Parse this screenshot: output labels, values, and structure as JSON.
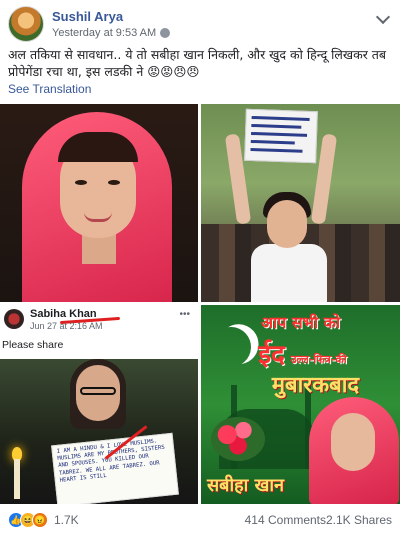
{
  "post": {
    "author": "Sushil Arya",
    "timestamp": "Yesterday at 9:53 AM",
    "text": "अल तकिया से सावधान.. ये तो सबीहा खान निकली, और खुद को हिन्दू लिखकर तब प्रोपेगेंडा रचा था, इस लडकी ने 😡😡😠😠",
    "see_translation": "See Translation"
  },
  "photos": {
    "screenshot": {
      "name": "Sabiha Khan",
      "date": "Jun 27 at 2:16 AM",
      "caption": "Please share",
      "more": "•••",
      "sign_text": "I AM A HINDU & I LOVE MUSLIMS. MUSLIMS ARE MY BROTHERS, SISTERS AND SPOUSES. YOU KILLED OUR TABREZ. WE ALL ARE TABREZ. OUR HEART IS STILL"
    },
    "greeting": {
      "line1": "आप सभी को",
      "eid": "ईद",
      "ul_fitr": "उल्ल-फित्र-की",
      "line3": "मुबारकबाद",
      "name": "सबीहा खान"
    }
  },
  "footer": {
    "reaction_count": "1.7K",
    "comments": "414 Comments",
    "shares": "2.1K Shares"
  },
  "colors": {
    "link": "#385898",
    "muted": "#606770",
    "like": "#1877f2"
  }
}
